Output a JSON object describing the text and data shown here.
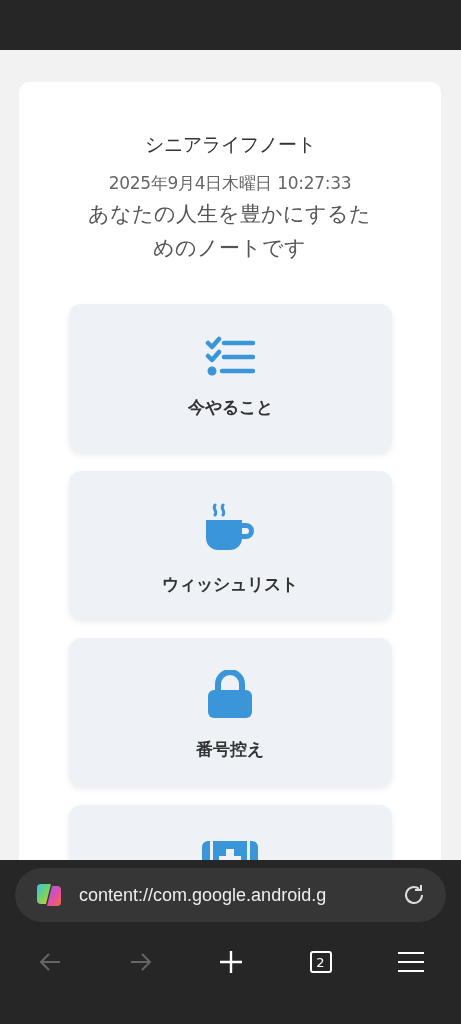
{
  "app": {
    "title": "シニアライフノート",
    "datetime": "2025年9月4日木曜日 10:27:33",
    "subtitle": "あなたの人生を豊かにするためのノートです"
  },
  "menu": [
    {
      "kind": "checklist",
      "label": "今やること"
    },
    {
      "kind": "cup",
      "label": "ウィッシュリスト"
    },
    {
      "kind": "lock",
      "label": "番号控え"
    },
    {
      "kind": "medkit"
    }
  ],
  "browser": {
    "url": "content://com.google.android.g",
    "back_disabled": true,
    "forward_disabled": true,
    "tab_count": "2"
  }
}
